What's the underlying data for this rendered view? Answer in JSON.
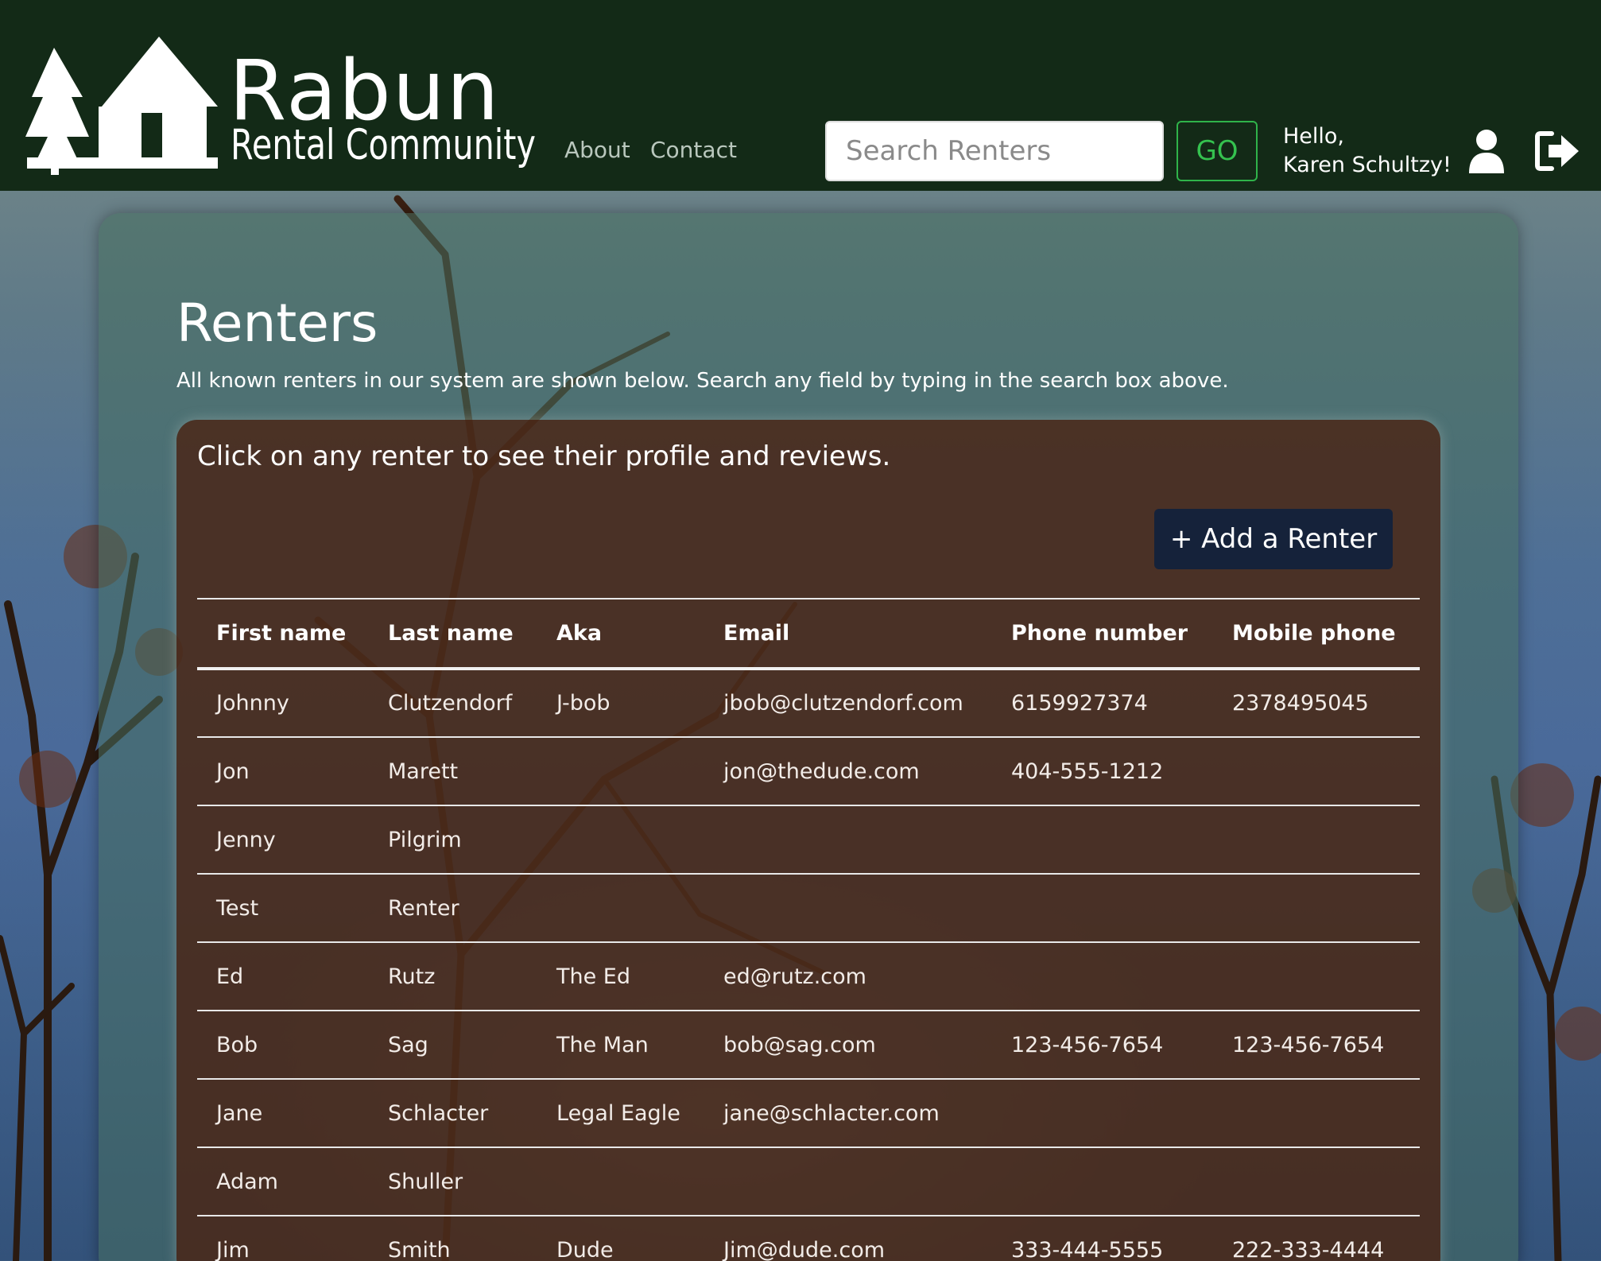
{
  "header": {
    "logo_title": "Rabun",
    "logo_subtitle": "Rental Community",
    "nav": [
      {
        "label": "About"
      },
      {
        "label": "Contact"
      }
    ],
    "search": {
      "placeholder": "Search Renters",
      "value": ""
    },
    "go_label": "GO",
    "greeting_line1": "Hello,",
    "greeting_line2": "Karen Schultzy!"
  },
  "main": {
    "title": "Renters",
    "description": "All known renters in our system are shown below. Search any field by typing in the search box above.",
    "card_hint": "Click on any renter to see their profile and reviews.",
    "add_button_label": "+ Add a Renter",
    "table": {
      "columns": [
        "First name",
        "Last name",
        "Aka",
        "Email",
        "Phone number",
        "Mobile phone"
      ],
      "rows": [
        [
          "Johnny",
          "Clutzendorf",
          "J-bob",
          "jbob@clutzendorf.com",
          "6159927374",
          "2378495045"
        ],
        [
          "Jon",
          "Marett",
          "",
          "jon@thedude.com",
          "404-555-1212",
          ""
        ],
        [
          "Jenny",
          "Pilgrim",
          "",
          "",
          "",
          ""
        ],
        [
          "Test",
          "Renter",
          "",
          "",
          "",
          ""
        ],
        [
          "Ed",
          "Rutz",
          "The Ed",
          "ed@rutz.com",
          "",
          ""
        ],
        [
          "Bob",
          "Sag",
          "The Man",
          "bob@sag.com",
          "123-456-7654",
          "123-456-7654"
        ],
        [
          "Jane",
          "Schlacter",
          "Legal Eagle",
          "jane@schlacter.com",
          "",
          ""
        ],
        [
          "Adam",
          "Shuller",
          "",
          "",
          "",
          ""
        ],
        [
          "Jim",
          "Smith",
          "Dude",
          "Jim@dude.com",
          "333-444-5555",
          "222-333-4444"
        ]
      ]
    }
  },
  "icons": {
    "logo": "trees-and-house-icon",
    "user": "user-icon",
    "logout": "logout-icon"
  },
  "colors": {
    "header_bg": "#132a17",
    "go_green": "#35c24f",
    "add_button_bg": "#15223a"
  }
}
